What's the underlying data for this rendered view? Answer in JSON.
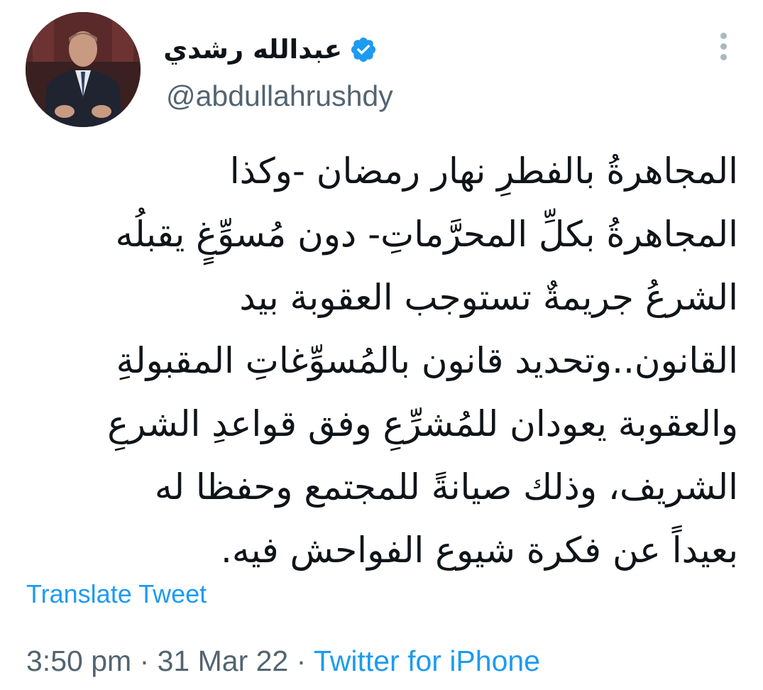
{
  "author": {
    "display_name": "عبدالله رشدي",
    "handle": "@abdullahrushdy",
    "verified": true,
    "verified_color": "#1d9bf0"
  },
  "tweet": {
    "lines": [
      "المجاهرةُ بالفطرِ نهار رمضان -وكذا",
      "المجاهرةُ بكلِّ المحرَّماتِ- دون مُسوِّغٍ يقبلُه",
      "الشرعُ جريمةٌ تستوجب العقوبة بيد",
      "القانون..وتحديد قانون بالمُسوِّغاتِ المقبولةِ",
      "والعقوبة يعودان للمُشرِّعِ وفق قواعدِ الشرعِ",
      "الشريف، وذلك صيانةً للمجتمع وحفظا له",
      "بعيداً عن فكرة شيوع الفواحش فيه."
    ],
    "translate_label": "Translate Tweet"
  },
  "meta": {
    "time": "3:50 pm",
    "separator": "·",
    "date": "31 Mar 22",
    "source": "Twitter for iPhone"
  },
  "icons": {
    "more": "more-vertical-icon",
    "verified": "verified-badge-icon"
  },
  "colors": {
    "link": "#1d9bf0",
    "secondary_text": "#536471",
    "primary_text": "#0f1419"
  }
}
